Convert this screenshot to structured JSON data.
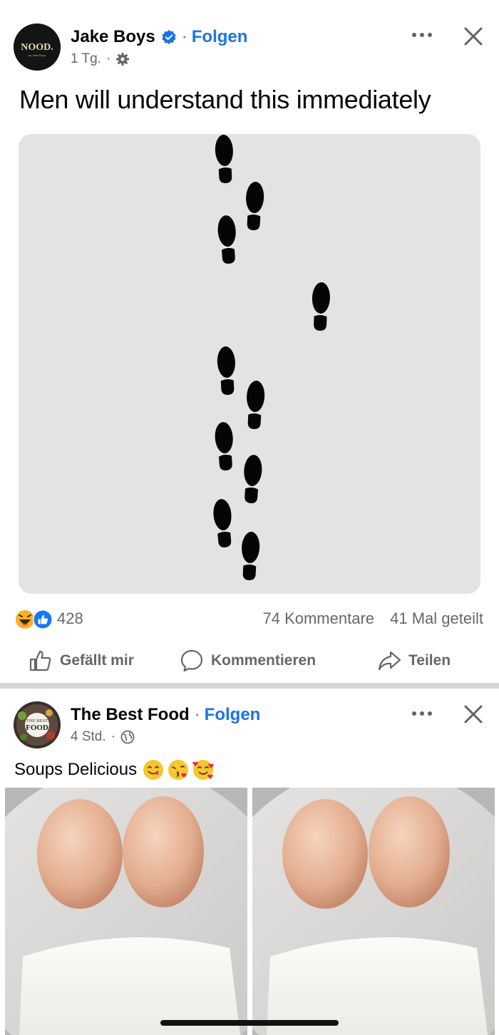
{
  "posts": [
    {
      "author": "Jake Boys",
      "verified": true,
      "follow_label": "Folgen",
      "time": "1 Tg.",
      "audience_icon": "gear-icon",
      "avatar_text": "NOOD.",
      "avatar_subtext": "by Jake Boys",
      "text": "Men will understand this immediately",
      "image_icon": "footprints",
      "reaction_icons": [
        "haha-icon",
        "like-icon"
      ],
      "reactions": "428",
      "comments": "74 Kommentare",
      "shares": "41 Mal geteilt",
      "actions": {
        "like": "Gefällt mir",
        "comment": "Kommentieren",
        "share": "Teilen"
      }
    },
    {
      "author": "The Best Food",
      "follow_label": "Folgen",
      "time": "4 Std.",
      "audience_icon": "globe-icon",
      "avatar_text_top": "THE BEST",
      "avatar_text_bottom": "FOOD",
      "text": "Soups Delicious",
      "emojis": [
        "😋",
        "😘",
        "🥰"
      ]
    }
  ],
  "colors": {
    "link_blue": "#1b74e4",
    "secondary_text": "#65676b",
    "divider": "#d4d6da"
  }
}
